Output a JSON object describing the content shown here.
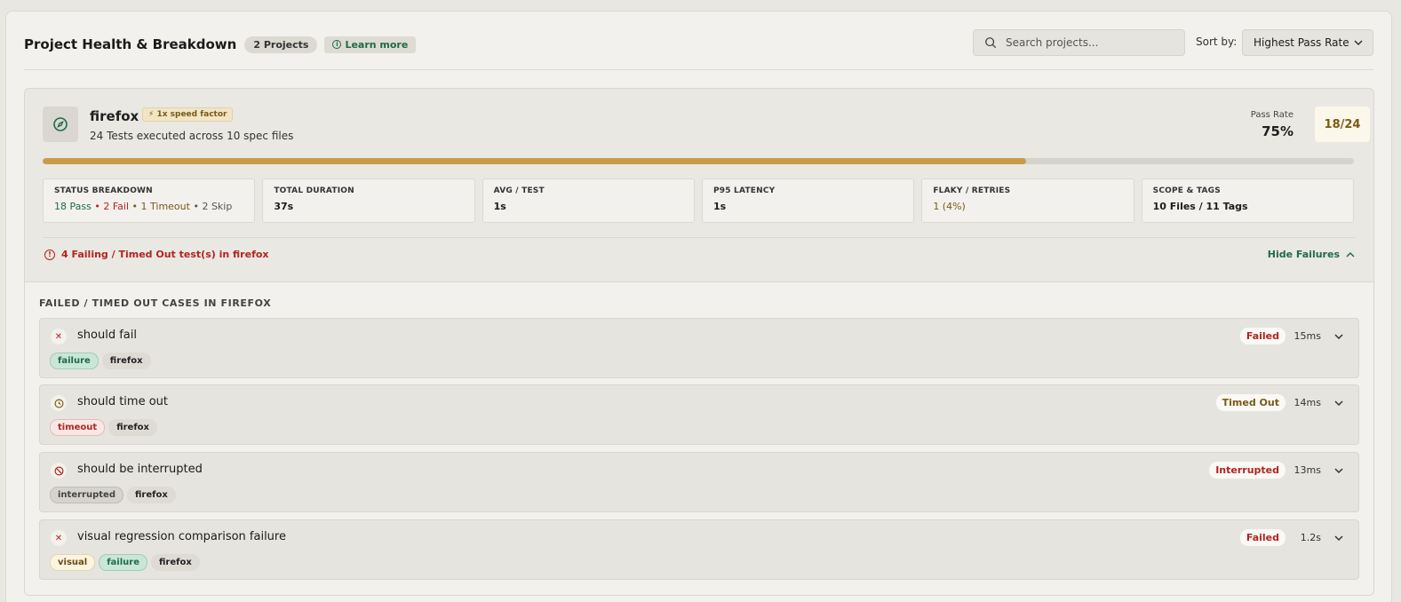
{
  "header": {
    "title": "Project Health & Breakdown",
    "projects_count": "2 Projects",
    "learn_more": "Learn more",
    "search_placeholder": "Search projects...",
    "sort_label": "Sort by:",
    "sort_value": "Highest Pass Rate"
  },
  "project": {
    "name": "firefox",
    "speed_badge": "⚡ 1x speed factor",
    "subtitle": "24 Tests executed across 10 spec files",
    "pass_rate_label": "Pass Rate",
    "pass_rate_value": "75%",
    "pass_fraction": "18/24",
    "progress": 0.75,
    "stats": {
      "status": {
        "label": "STATUS BREAKDOWN",
        "pass": "18 Pass",
        "fail": "2 Fail",
        "timeout": "1 Timeout",
        "skip": "2 Skip"
      },
      "duration": {
        "label": "TOTAL DURATION",
        "value": "37s"
      },
      "avg": {
        "label": "AVG / TEST",
        "value": "1s"
      },
      "p95": {
        "label": "P95 LATENCY",
        "value": "1s"
      },
      "flaky": {
        "label": "FLAKY / RETRIES",
        "value": "1 (4%)"
      },
      "scope": {
        "label": "SCOPE & TAGS",
        "value": "10 Files / 11 Tags"
      }
    },
    "failing_header": "4 Failing / Timed Out test(s) in firefox",
    "hide_failures": "Hide Failures",
    "section_title": "FAILED / TIMED OUT CASES IN FIREFOX",
    "cases": [
      {
        "name": "should fail",
        "status": "Failed",
        "duration": "15ms",
        "tags": [
          "failure",
          "firefox"
        ]
      },
      {
        "name": "should time out",
        "status": "Timed Out",
        "duration": "14ms",
        "tags": [
          "timeout",
          "firefox"
        ]
      },
      {
        "name": "should be interrupted",
        "status": "Interrupted",
        "duration": "13ms",
        "tags": [
          "interrupted",
          "firefox"
        ]
      },
      {
        "name": "visual regression comparison failure",
        "status": "Failed",
        "duration": "1.2s",
        "tags": [
          "visual",
          "failure",
          "firefox"
        ]
      }
    ]
  },
  "icons": {
    "search": "search-icon",
    "project": "compass-icon",
    "alert": "alert-circle-icon",
    "close": "x-icon",
    "clock": "clock-icon",
    "ban": "ban-icon",
    "chevron_down": "chevron-down-icon",
    "chevron_up": "chevron-up-icon"
  },
  "colors": {
    "pass": "#1e6b48",
    "fail": "#b3241e",
    "warn": "#7a5a14",
    "progress": "#c99c4d"
  }
}
